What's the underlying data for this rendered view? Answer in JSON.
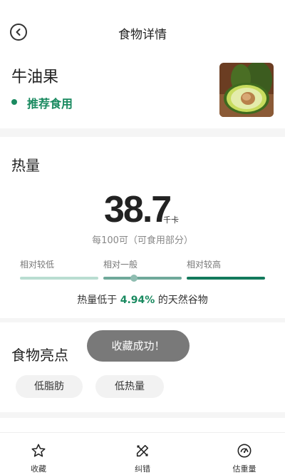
{
  "header": {
    "title": "食物详情"
  },
  "food": {
    "name": "牛油果",
    "recommendation": "推荐食用"
  },
  "energy": {
    "section_title": "热量",
    "value": "38.7",
    "unit": "千卡",
    "per_unit": "每100可（可食用部分）",
    "levels": [
      "相对较低",
      "相对一般",
      "相对较高"
    ],
    "current_level": "相对一般",
    "compare_prefix": "热量低于",
    "compare_value": "4.94%",
    "compare_suffix": "的天然谷物"
  },
  "highlights": {
    "section_title": "食物亮点",
    "tags": [
      "低脂肪",
      "低热量"
    ]
  },
  "toast": {
    "text": "收藏成功！"
  },
  "tabbar": {
    "items": [
      "收藏",
      "纠错",
      "估重量"
    ]
  },
  "colors": {
    "accent": "#1a8a60",
    "bar_low": "#b9ddd1",
    "bar_mid": "#6fa99a",
    "bar_high": "#137a5c"
  },
  "icons": {
    "back": "back-circle-icon",
    "fav": "star-icon",
    "fix": "pencil-ruler-icon",
    "est": "gauge-icon"
  }
}
